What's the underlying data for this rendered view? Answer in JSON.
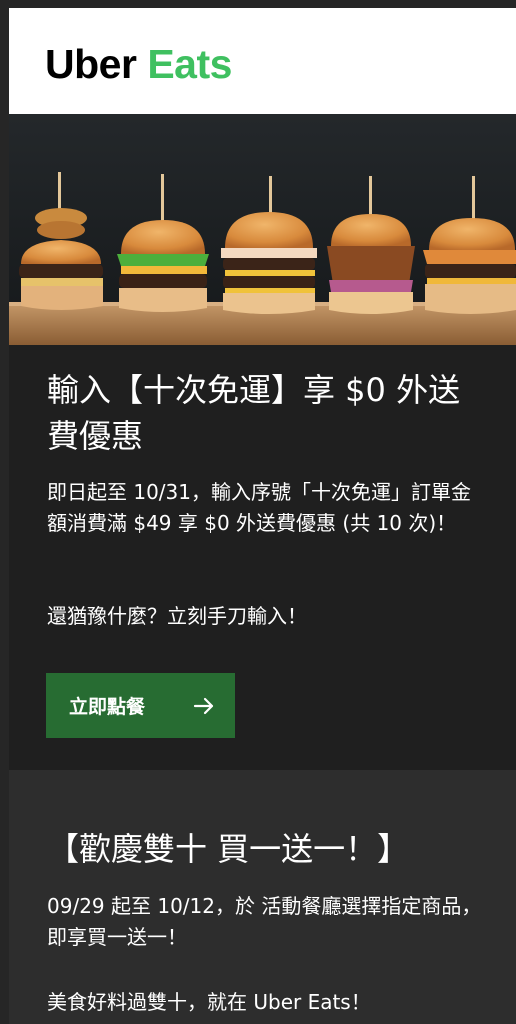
{
  "header": {
    "logo_uber": "Uber",
    "logo_eats": "Eats"
  },
  "hero": {
    "image": "burger-sliders-photo"
  },
  "promo1": {
    "title": "輸入【十次免運】享 $0 外送費優惠",
    "body": "即日起至 10/31，輸入序號「十次免運」訂單金額消費滿 $49 享 $0 外送費優惠 (共 10 次)！",
    "tagline": "還猶豫什麼？立刻手刀輸入！",
    "cta_label": "立即點餐",
    "cta_icon": "arrow-right-icon"
  },
  "promo2": {
    "title": "【歡慶雙十 買一送一！】",
    "body": "09/29 起至 10/12，於 活動餐廳選擇指定商品，即享買一送一！",
    "tagline": "美食好料過雙十，就在 Uber Eats！"
  },
  "colors": {
    "page_bg": "#262626",
    "card_bg": "#1f1f1f",
    "card2_bg": "#2d2d2d",
    "brand_green": "#3fc060",
    "button_green": "#276c32"
  }
}
